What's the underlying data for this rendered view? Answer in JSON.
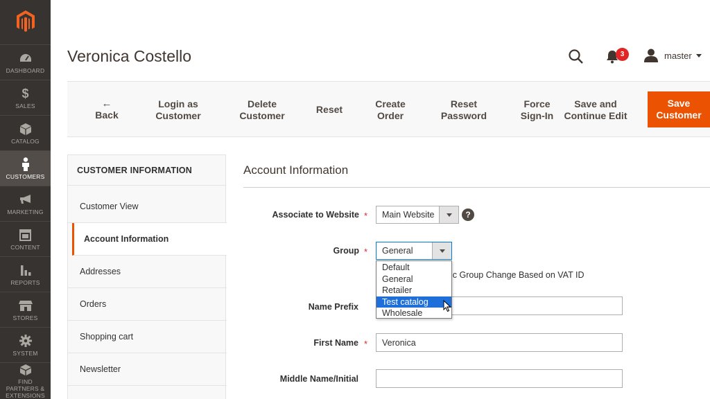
{
  "sidebar": {
    "items": [
      {
        "label": "DASHBOARD",
        "icon": "dashboard-icon"
      },
      {
        "label": "SALES",
        "icon": "dollar-icon"
      },
      {
        "label": "CATALOG",
        "icon": "cube-icon"
      },
      {
        "label": "CUSTOMERS",
        "icon": "person-icon",
        "active": true
      },
      {
        "label": "MARKETING",
        "icon": "megaphone-icon"
      },
      {
        "label": "CONTENT",
        "icon": "layout-icon"
      },
      {
        "label": "REPORTS",
        "icon": "bar-chart-icon"
      },
      {
        "label": "STORES",
        "icon": "store-icon"
      },
      {
        "label": "SYSTEM",
        "icon": "gear-icon"
      },
      {
        "label": "FIND PARTNERS & EXTENSIONS",
        "icon": "boxes-icon"
      }
    ]
  },
  "header": {
    "title": "Veronica Costello",
    "notification_count": "3",
    "username": "master"
  },
  "actions": {
    "back": "Back",
    "login_as": "Login as",
    "login_customer": "Customer",
    "delete": "Delete",
    "delete_customer": "Customer",
    "reset": "Reset",
    "create": "Create",
    "create_order": "Order",
    "reset_pw": "Reset",
    "reset_pw2": "Password",
    "force": "Force",
    "force2": "Sign-In",
    "save_continue": "Save and",
    "save_continue2": "Continue Edit",
    "save": "Save",
    "save2": "Customer"
  },
  "tabs": {
    "heading": "CUSTOMER INFORMATION",
    "items": [
      "Customer View",
      "Account Information",
      "Addresses",
      "Orders",
      "Shopping cart",
      "Newsletter"
    ]
  },
  "form": {
    "section_title": "Account Information",
    "associate_label": "Associate to Website",
    "associate_value": "Main Website",
    "group_label": "Group",
    "group_value": "General",
    "group_options": [
      "Default",
      "General",
      "Retailer",
      "Test catalog",
      "Wholesale"
    ],
    "group_highlighted": "Test catalog",
    "vat_text": "ic Group Change Based on VAT ID",
    "prefix_label": "Name Prefix",
    "prefix_value": "",
    "first_label": "First Name",
    "first_value": "Veronica",
    "middle_label": "Middle Name/Initial",
    "middle_value": "",
    "required_mark": "*",
    "help_mark": "?"
  },
  "colors": {
    "sidebar_bg": "#373330",
    "accent": "#eb5202",
    "badge": "#e22626",
    "selection": "#1e6fd9"
  }
}
